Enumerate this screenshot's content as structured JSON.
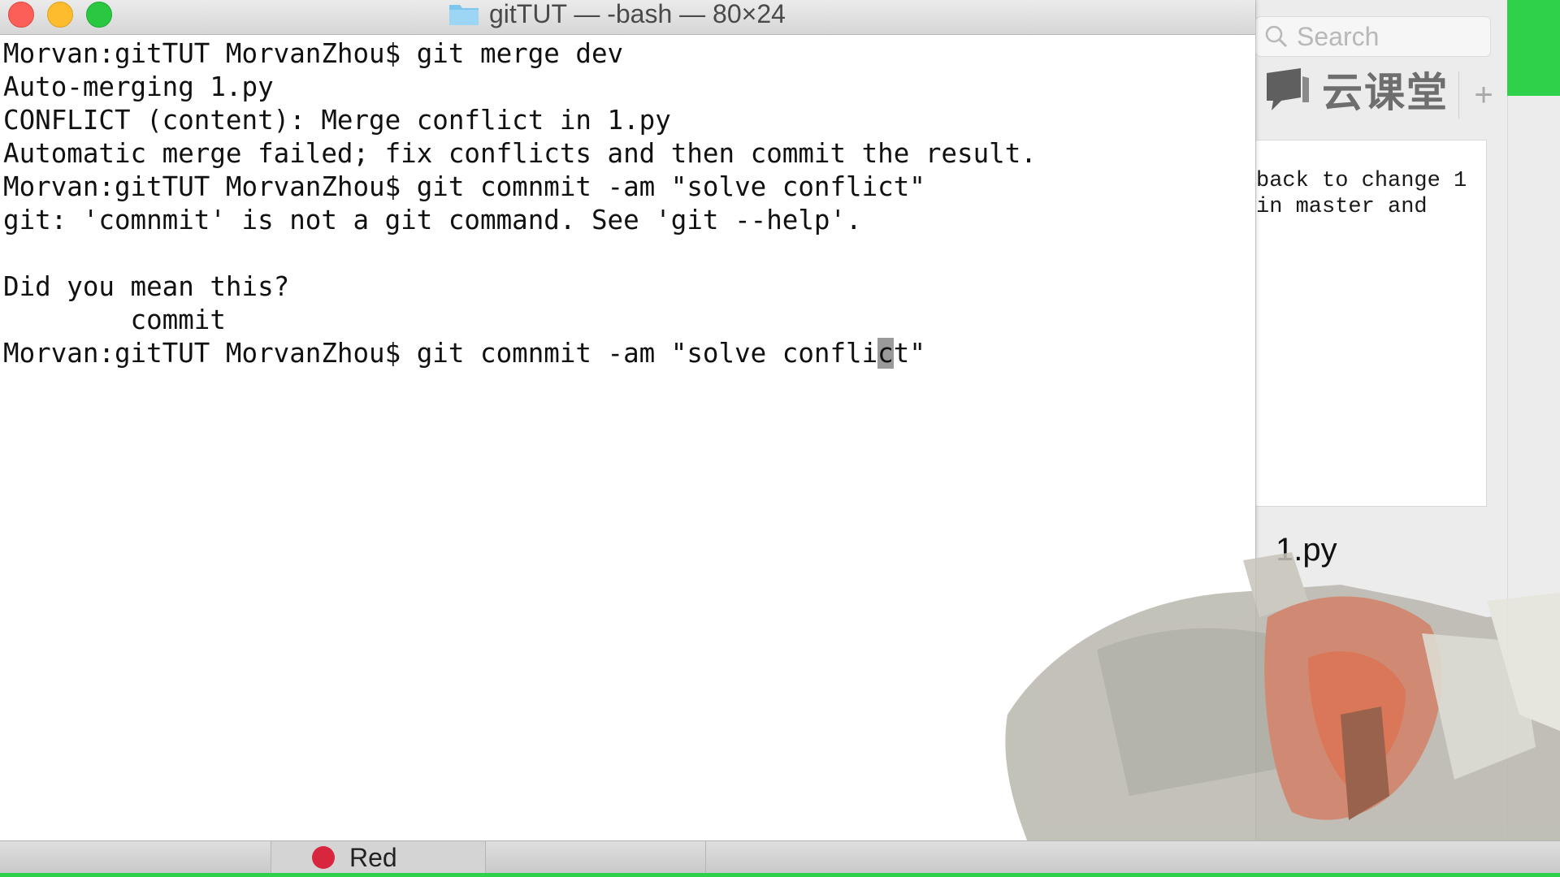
{
  "window": {
    "title": "gitTUT — -bash — 80×24"
  },
  "terminal": {
    "lines": [
      "Morvan:gitTUT MorvanZhou$ git merge dev",
      "Auto-merging 1.py",
      "CONFLICT (content): Merge conflict in 1.py",
      "Automatic merge failed; fix conflicts and then commit the result.",
      "Morvan:gitTUT MorvanZhou$ git comnmit -am \"solve conflict\"",
      "git: 'comnmit' is not a git command. See 'git --help'.",
      "",
      "Did you mean this?",
      "        commit"
    ],
    "current_before_cursor": "Morvan:gitTUT MorvanZhou$ git comnmit -am \"solve confli",
    "current_cursor_char": "c",
    "current_after_cursor": "t\""
  },
  "side_app": {
    "search_placeholder": "Search",
    "brand": "云课堂",
    "plus": "+",
    "note_lines": [
      "back to change 1",
      "in master and"
    ],
    "file_name": "1.py"
  },
  "tabbar": {
    "tag_label": "Red",
    "tag_color": "#d7263d"
  },
  "colors": {
    "accent_green": "#2fd04a",
    "close": "#fc5f57",
    "minimize": "#fdbc2e",
    "maximize": "#29c840"
  }
}
